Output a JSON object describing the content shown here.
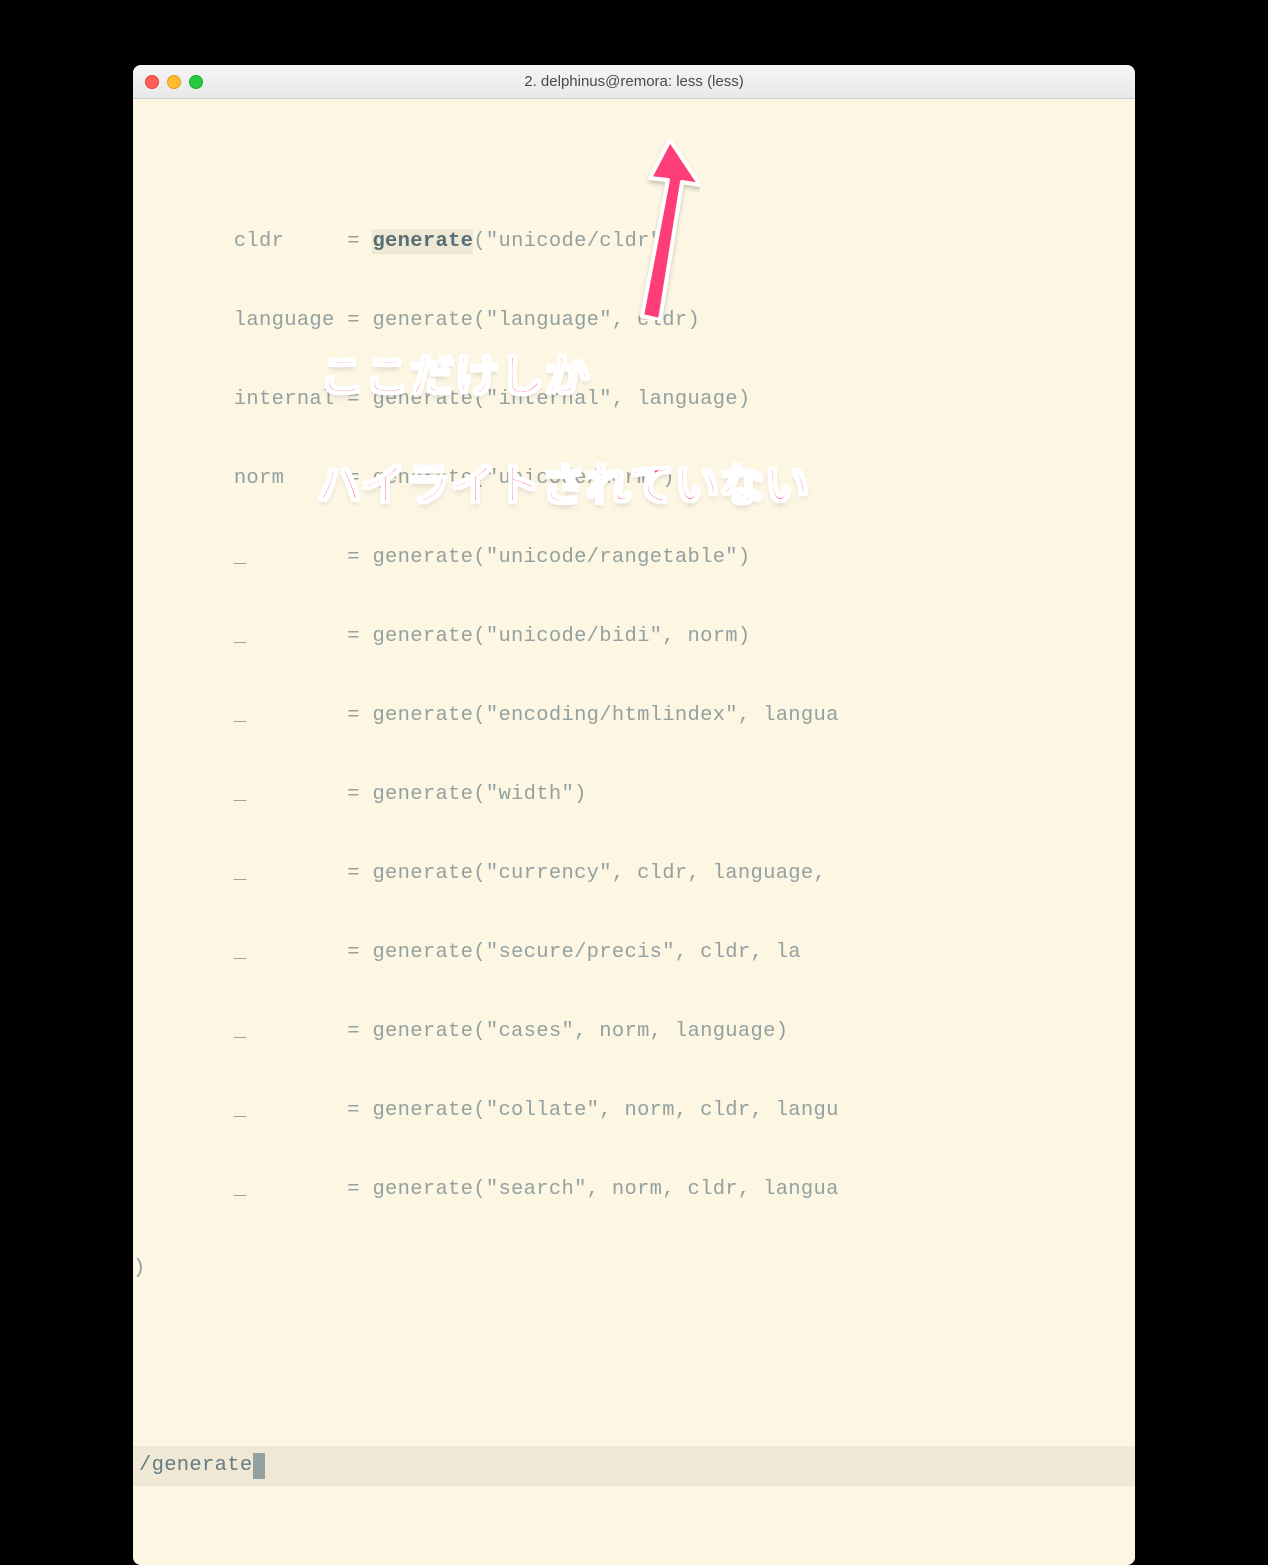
{
  "window": {
    "title": "2. delphinus@remora: less (less)"
  },
  "code": {
    "l1_pre": "        cldr     = ",
    "l1_hl": "generate",
    "l1_post": "(\"unicode/cldr\")",
    "l2": "        language = generate(\"language\", cldr)",
    "l3": "        internal = generate(\"internal\", language)",
    "l4": "        norm     = generate(\"unicode/norm\")",
    "l5": "        _        = generate(\"unicode/rangetable\")",
    "l6": "        _        = generate(\"unicode/bidi\", norm)",
    "l7": "        _        = generate(\"encoding/htmlindex\", langua",
    "l8": "        _        = generate(\"width\")",
    "l9": "        _        = generate(\"currency\", cldr, language, ",
    "l10": "        _        = generate(\"secure/precis\", cldr, la",
    "l11": "        _        = generate(\"cases\", norm, language)",
    "l12": "        _        = generate(\"collate\", norm, cldr, langu",
    "l13": "        _        = generate(\"search\", norm, cldr, langua",
    "l14": ")"
  },
  "search": {
    "query": "/generate"
  },
  "annotation": {
    "line1": "ここだけしか",
    "line2": "ハイライトされていない"
  },
  "colors": {
    "bg": "#fdf6e3",
    "text": "#93a1a1",
    "highlight_bg": "#eee8d5",
    "accent_pink": "#ff3c78"
  }
}
